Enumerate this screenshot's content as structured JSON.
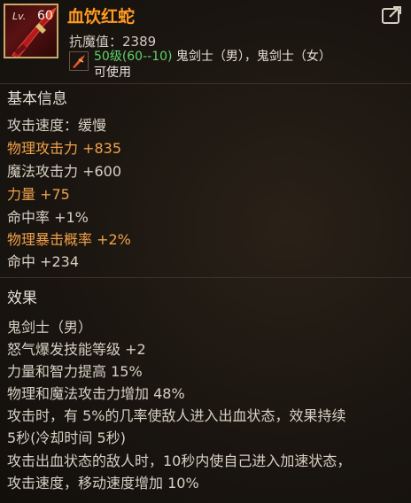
{
  "item": {
    "level_badge": "Lv.",
    "level": "60",
    "name": "血饮红蛇",
    "anti_magic": "抗魔值：2389",
    "req_level": "50级(60--10)",
    "req_classes": " 鬼剑士（男），鬼剑士（女）",
    "usable": "可使用",
    "icon": "red-blade-weapon-icon",
    "share_icon": "share-icon"
  },
  "basic": {
    "title": "基本信息",
    "stats": [
      {
        "text": "攻击速度：缓慢",
        "color": "white"
      },
      {
        "text": "物理攻击力 +835",
        "color": "orange"
      },
      {
        "text": "魔法攻击力 +600",
        "color": "white"
      },
      {
        "text": "力量 +75",
        "color": "orange"
      },
      {
        "text": "命中率 +1%",
        "color": "white"
      },
      {
        "text": "物理暴击概率 +2%",
        "color": "orange"
      },
      {
        "text": "命中 +234",
        "color": "white"
      }
    ]
  },
  "effects": {
    "title": "效果",
    "lines": [
      "鬼剑士（男）",
      "怒气爆发技能等级 +2",
      "力量和智力提高 15%",
      "物理和魔法攻击力增加 48%",
      "攻击时，有 5%的几率使敌人进入出血状态，效果持续",
      "5秒(冷却时间 5秒)",
      "攻击出血状态的敌人时，10秒内使自己进入加速状态，",
      "攻击速度，移动速度增加 10%"
    ]
  },
  "colors": {
    "name": "#ff9a22",
    "highlight": "#f0a14a",
    "level_req": "#5fd36a",
    "text": "#d6d0c4"
  }
}
